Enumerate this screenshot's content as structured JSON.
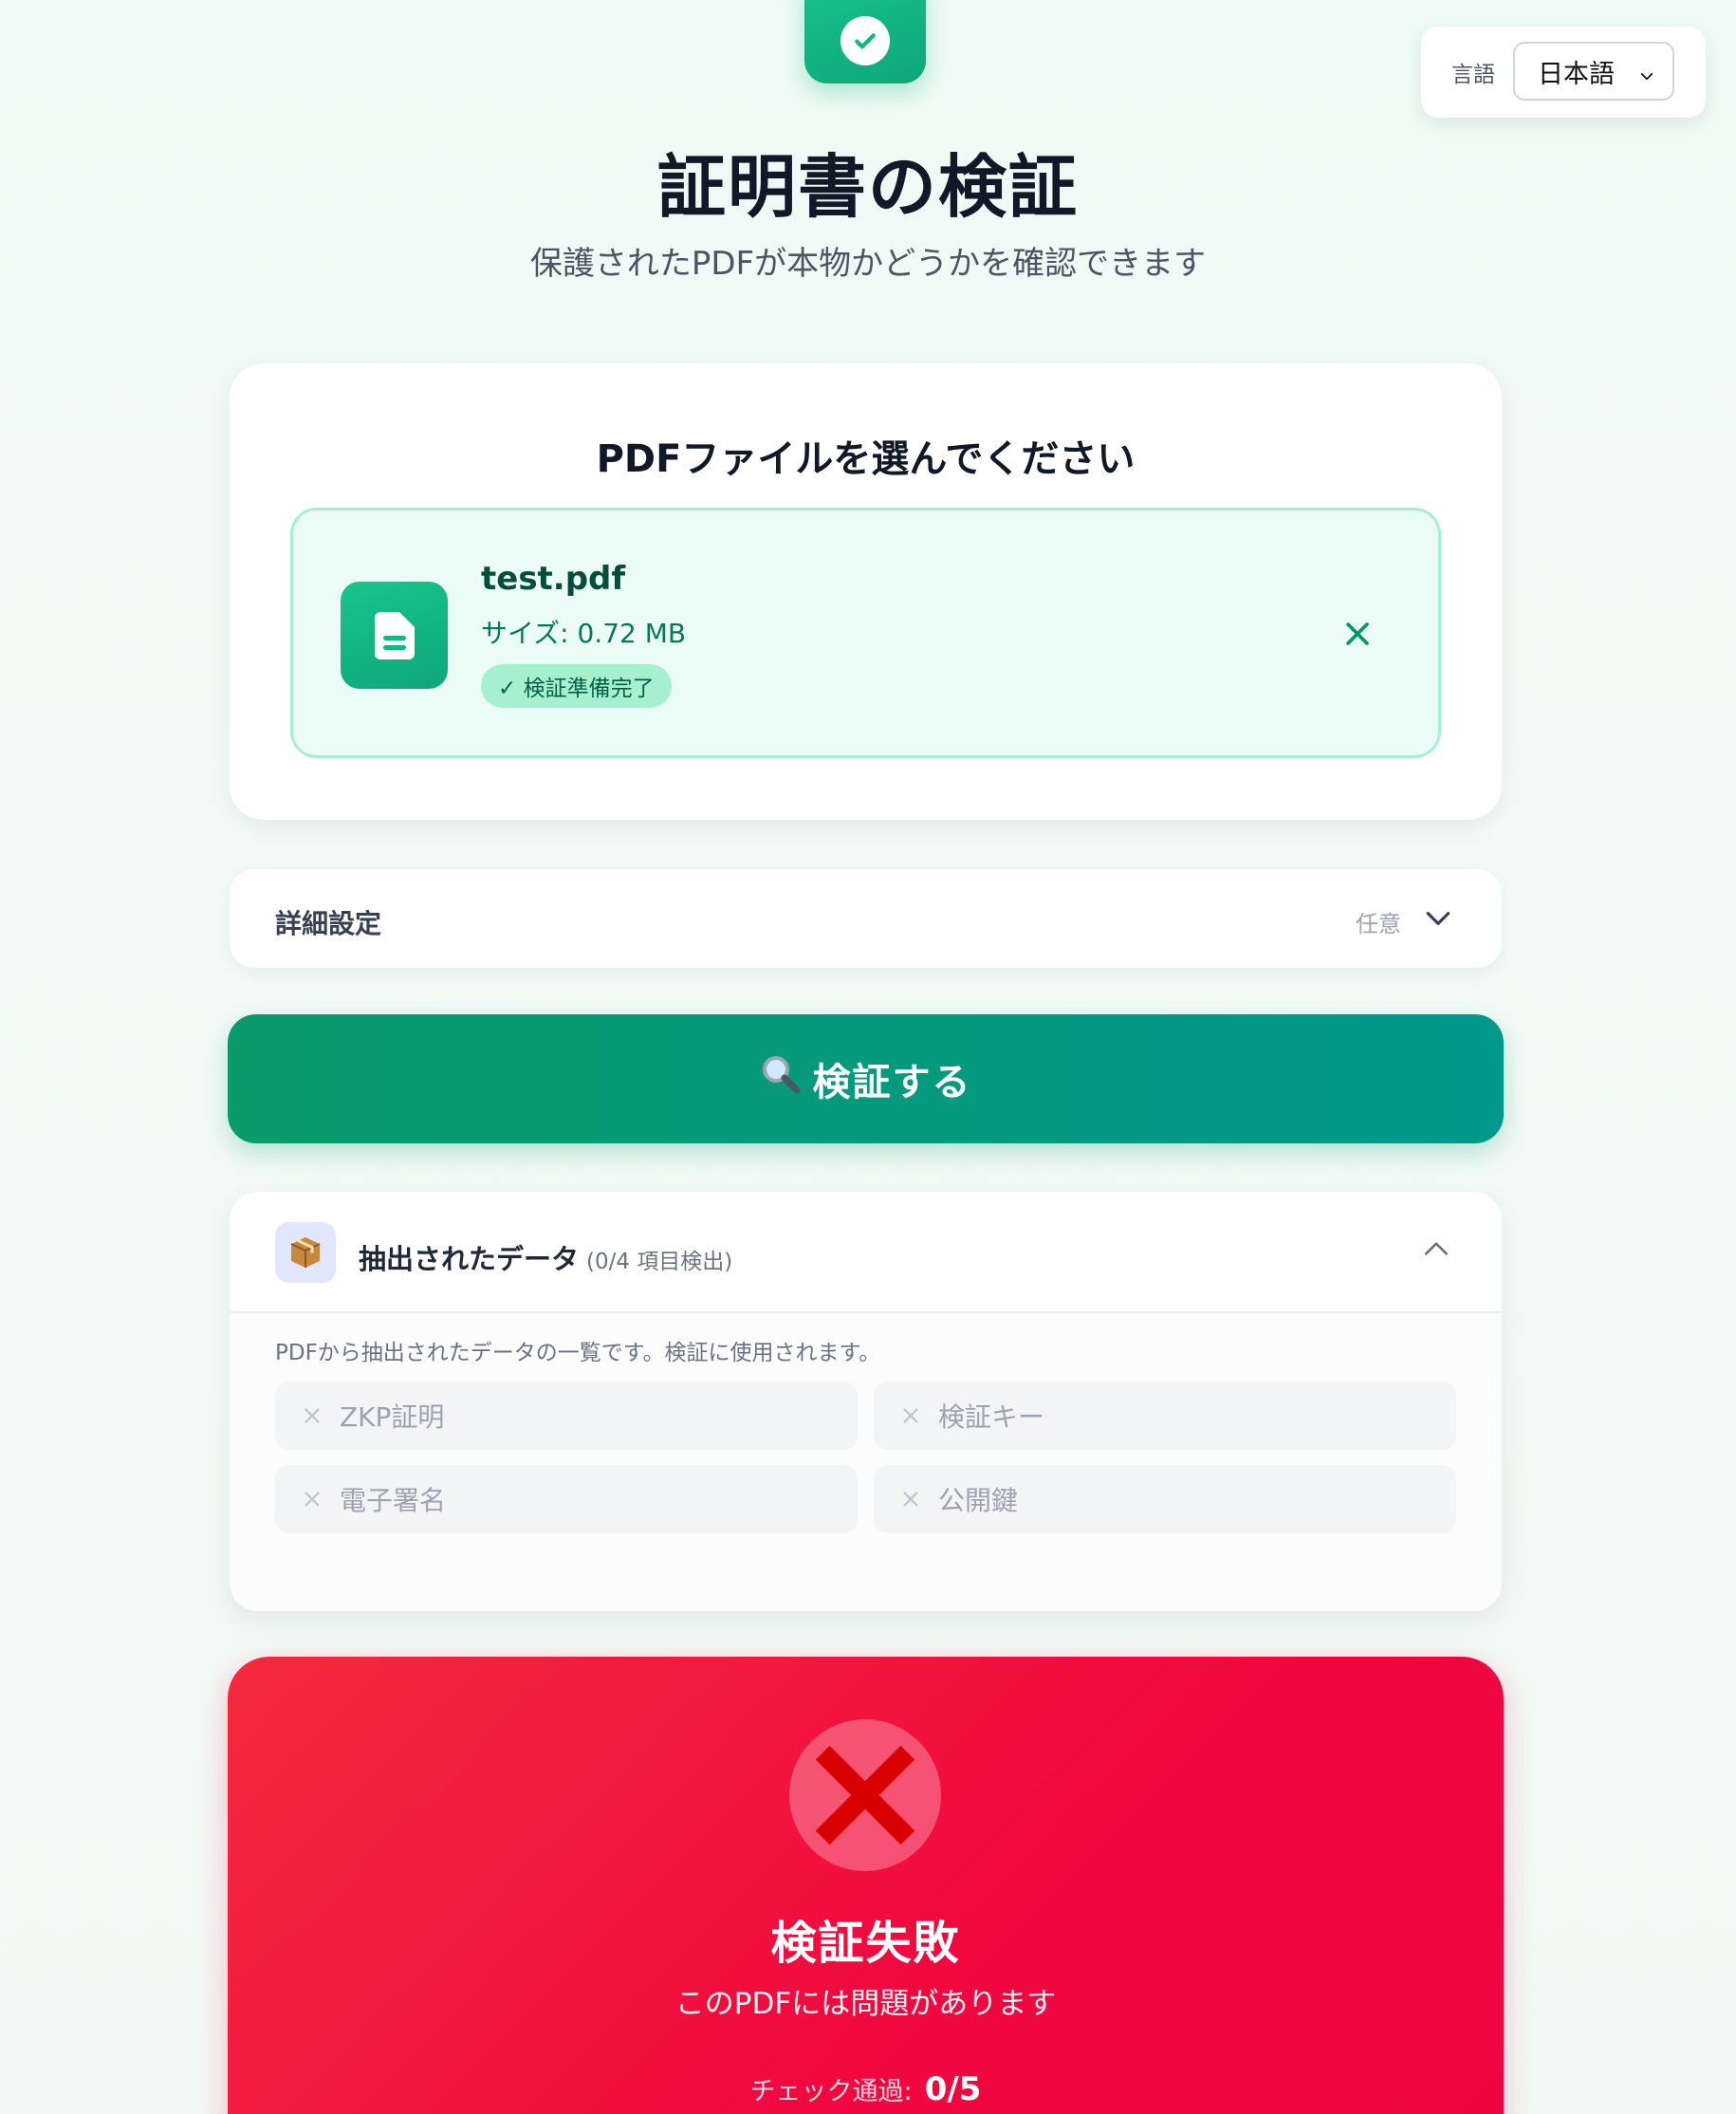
{
  "language": {
    "label": "言語",
    "selected": "日本語"
  },
  "header": {
    "title": "証明書の検証",
    "subtitle": "保護されたPDFが本物かどうかを確認できます"
  },
  "upload": {
    "title": "PDFファイルを選んでください",
    "file_name": "test.pdf",
    "file_size": "サイズ: 0.72 MB",
    "status_badge": "✓ 検証準備完了"
  },
  "advanced": {
    "label": "詳細設定",
    "optional": "任意"
  },
  "verify_button": {
    "label": "検証する"
  },
  "extracted": {
    "title": "抽出されたデータ",
    "count": "(0/4 項目検出)",
    "description": "PDFから抽出されたデータの一覧です。検証に使用されます。",
    "items": [
      "ZKP証明",
      "検証キー",
      "電子署名",
      "公開鍵"
    ]
  },
  "result": {
    "title": "検証失敗",
    "subtitle": "このPDFには問題があります",
    "checks_label": "チェック通過:",
    "checks_value": "0/5"
  },
  "colors": {
    "primary": "#10b981",
    "button_start": "#0a9a6c",
    "button_end": "#00998c",
    "fail": "#f0073f"
  }
}
